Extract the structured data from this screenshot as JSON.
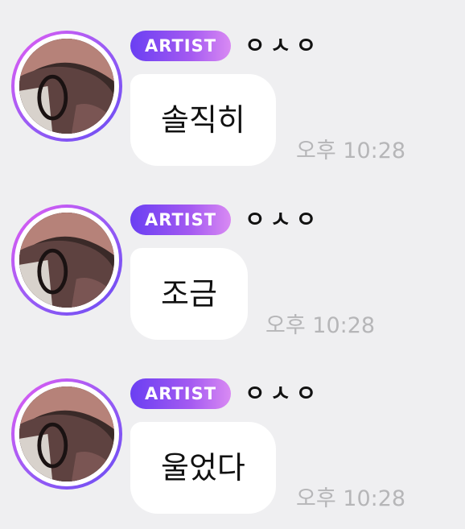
{
  "messages": [
    {
      "badge": "ARTIST",
      "nickname": "ㅇㅅㅇ",
      "text": "솔직히",
      "time": "오후 10:28"
    },
    {
      "badge": "ARTIST",
      "nickname": "ㅇㅅㅇ",
      "text": "조금",
      "time": "오후 10:28"
    },
    {
      "badge": "ARTIST",
      "nickname": "ㅇㅅㅇ",
      "text": "울었다",
      "time": "오후 10:28"
    }
  ],
  "colors": {
    "background": "#efeff1",
    "badge_start": "#6a3ff2",
    "badge_end": "#d98af3",
    "bubble": "#ffffff",
    "time": "#b6b6b8"
  }
}
